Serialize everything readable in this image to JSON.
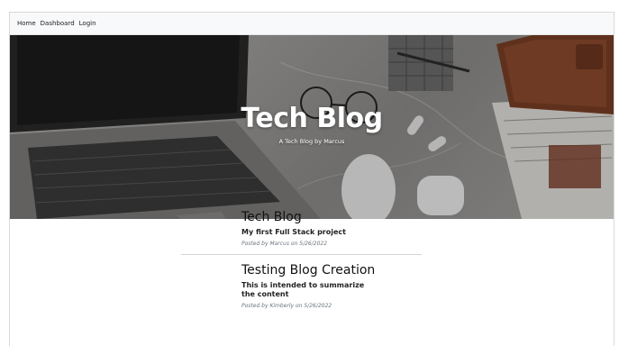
{
  "nav": {
    "items": [
      "Home",
      "Dashboard",
      "Login"
    ]
  },
  "hero": {
    "title": "Tech Blog",
    "subtitle": "A Tech Blog by Marcus"
  },
  "posts": [
    {
      "title": "Tech Blog",
      "summary": "My first Full Stack project",
      "meta": "Posted by Marcus on 5/26/2022"
    },
    {
      "title": "Testing Blog Creation",
      "summary": "This is intended to summarize the content",
      "meta": "Posted by Kimberly on 5/26/2022"
    }
  ]
}
